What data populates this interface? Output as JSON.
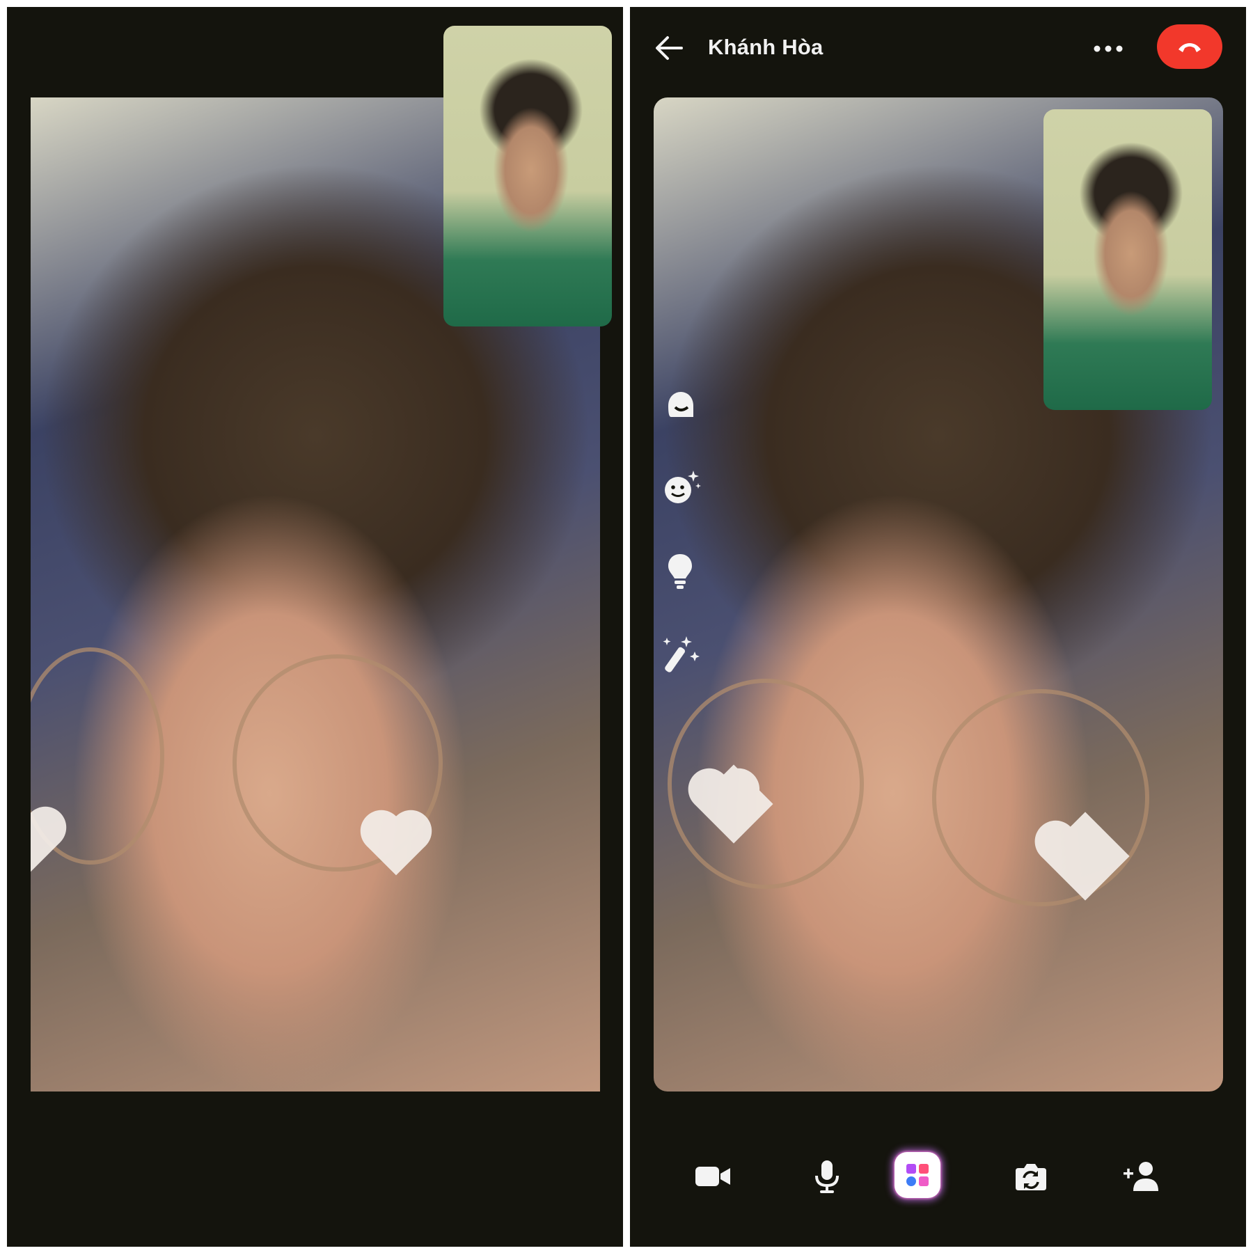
{
  "call": {
    "contact_name": "Khánh Hòa"
  },
  "icons": {
    "back": "arrow-left-icon",
    "more": "more-icon",
    "end_call": "end-call-icon",
    "effects": [
      "avatar-icon",
      "face-effects-icon",
      "lightbulb-icon",
      "magic-wand-icon"
    ],
    "toolbar": [
      "video-camera-icon",
      "microphone-icon",
      "apps-icon",
      "flip-camera-icon",
      "add-person-icon"
    ]
  },
  "colors": {
    "background": "#14140d",
    "end_call": "#f2382b",
    "icon": "#f3f3f3"
  }
}
